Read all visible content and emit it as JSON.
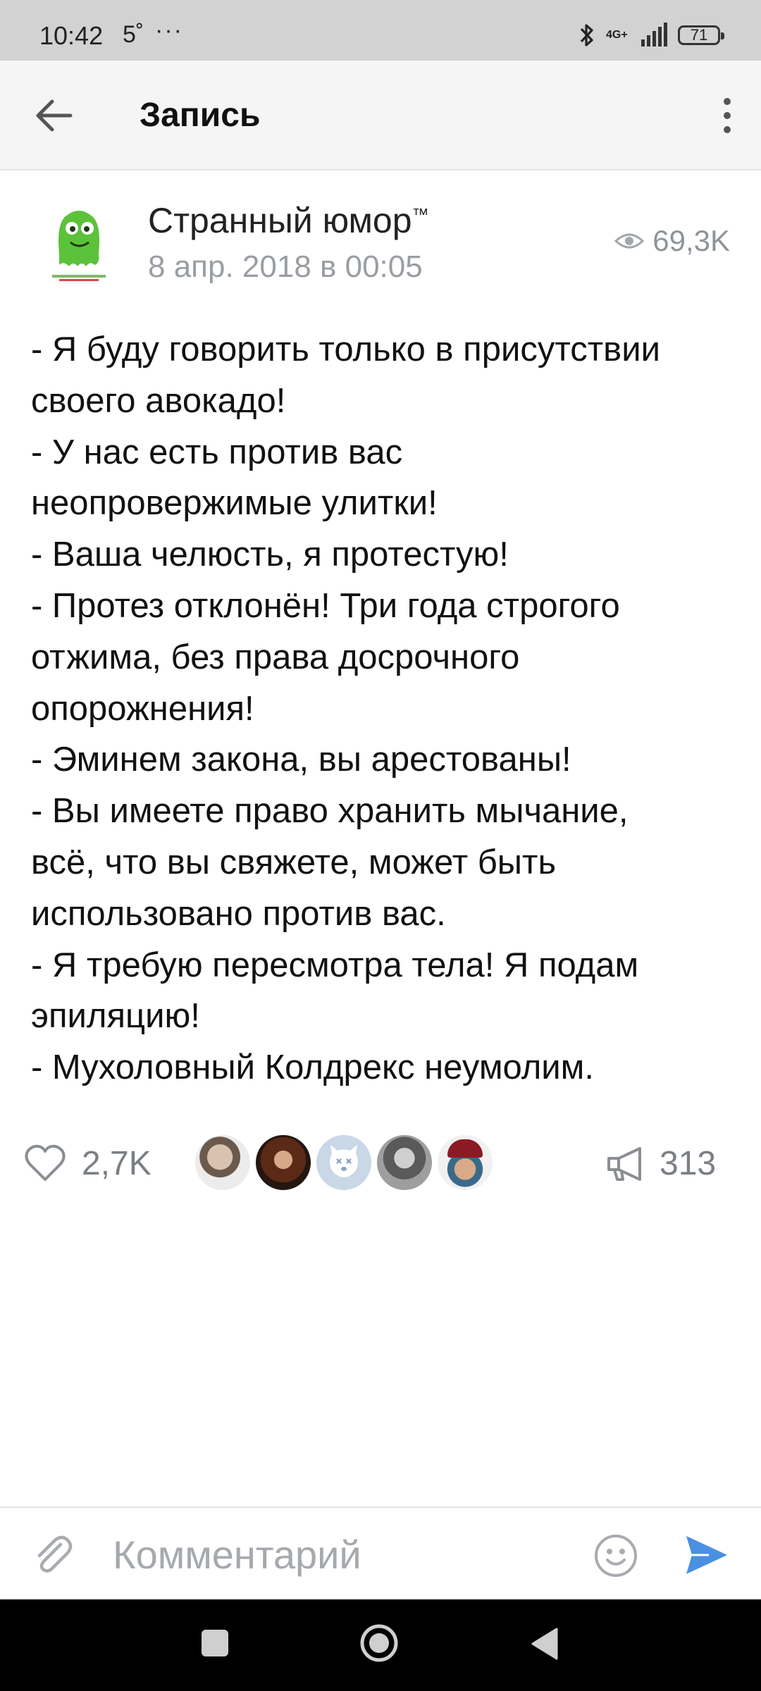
{
  "status_bar": {
    "time": "10:42",
    "temperature": "5˚",
    "overflow": "···",
    "network": "4G+",
    "battery": "71"
  },
  "header": {
    "title": "Запись",
    "back_icon": "arrow-left-icon",
    "more_icon": "more-vertical-icon"
  },
  "post": {
    "group_name": "Странный юмор",
    "trademark": "™",
    "date": "8 апр. 2018 в 00:05",
    "views": "69,3K",
    "text_lines": [
      "- Я буду говорить только в присутствии",
      "своего авокадо!",
      "- У нас есть против вас",
      "неопровержимые улитки!",
      "- Ваша челюсть, я протестую!",
      "- Протез отклонён! Три года строгого",
      "отжима, без права досрочного",
      "опорожнения!",
      "- Эминем закона, вы арестованы!",
      "- Вы имеете право хранить мычание,",
      "всё, что вы свяжете, может быть",
      "использовано против вас.",
      "- Я требую пересмотра тела! Я подам",
      "эпиляцию!",
      "- Мухоловный Колдрекс неумолим."
    ]
  },
  "actions": {
    "likes": "2,7K",
    "shares": "313",
    "like_icon": "heart-icon",
    "share_icon": "megaphone-icon",
    "liker_avatars": [
      "avatar-1",
      "avatar-2",
      "avatar-3",
      "avatar-4",
      "avatar-5"
    ]
  },
  "comment": {
    "placeholder": "Комментарий",
    "value": ""
  },
  "colors": {
    "status_bar_bg": "#d2d2d2",
    "header_bg": "#f5f5f5",
    "accent_blue": "#4a90e2",
    "muted_text": "#9a9ea3",
    "avatar_green": "#5cc23a"
  }
}
